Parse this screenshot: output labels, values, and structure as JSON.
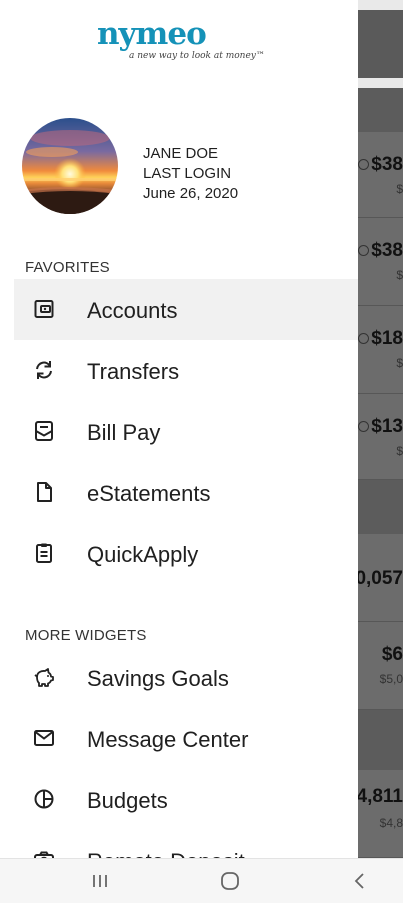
{
  "brand": {
    "logo_text": "nymeo",
    "tagline": "a new way to look at money™"
  },
  "profile": {
    "name": "JANE DOE",
    "last_login_label": "LAST LOGIN",
    "last_login_date": "June 26, 2020"
  },
  "favorites": {
    "heading": "FAVORITES",
    "items": [
      {
        "label": "Accounts",
        "icon": "wallet-icon",
        "active": true
      },
      {
        "label": "Transfers",
        "icon": "transfer-icon"
      },
      {
        "label": "Bill Pay",
        "icon": "bill-pay-icon"
      },
      {
        "label": "eStatements",
        "icon": "document-icon"
      },
      {
        "label": "QuickApply",
        "icon": "clipboard-icon"
      }
    ]
  },
  "more_widgets": {
    "heading": "MORE WIDGETS",
    "items": [
      {
        "label": "Savings Goals",
        "icon": "piggy-bank-icon"
      },
      {
        "label": "Message Center",
        "icon": "mail-icon"
      },
      {
        "label": "Budgets",
        "icon": "pie-chart-icon"
      },
      {
        "label": "Remote Deposit",
        "icon": "camera-icon"
      }
    ]
  },
  "background_rows": [
    {
      "amount": "$38",
      "sub": "$"
    },
    {
      "amount": "$38",
      "sub": "$"
    },
    {
      "amount": "$18",
      "sub": "$"
    },
    {
      "amount": "$13",
      "sub": "$"
    },
    {
      "amount": "0,057",
      "sub": ""
    },
    {
      "amount": "$6",
      "sub": "$5,0"
    },
    {
      "amount": "4,811",
      "sub": "$4,8"
    }
  ],
  "system_nav": {
    "recents": "recents-icon",
    "home": "home-icon",
    "back": "back-icon"
  },
  "colors": {
    "brand": "#1592b8",
    "active_bg": "#f1f1f1",
    "scrim": "#5c5c5c"
  }
}
